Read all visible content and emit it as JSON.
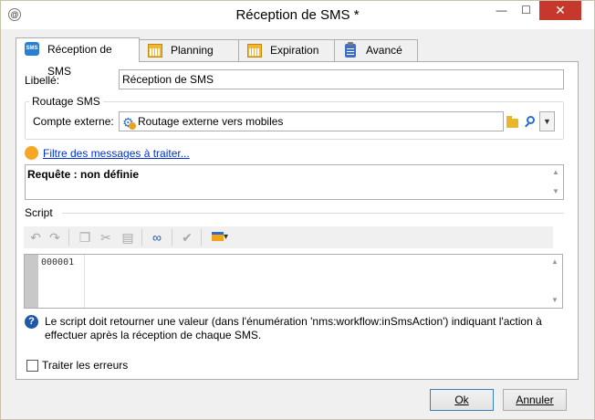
{
  "window": {
    "title": "Réception de SMS *",
    "minimize": "—",
    "maximize": "☐",
    "close": "✕"
  },
  "tabs": [
    {
      "label": "Réception de SMS",
      "icon": "sms-icon",
      "active": true
    },
    {
      "label": "Planning",
      "icon": "calendar-icon",
      "active": false
    },
    {
      "label": "Expiration",
      "icon": "calendar-icon",
      "active": false
    },
    {
      "label": "Avancé",
      "icon": "clipboard-icon",
      "active": false
    }
  ],
  "form": {
    "libelle_label": "Libellé:",
    "libelle_value": "Réception de SMS",
    "routage_group": "Routage SMS",
    "compte_label": "Compte externe:",
    "compte_value": "Routage externe vers mobiles",
    "filter_link": "Filtre des messages à traiter...",
    "query_text": "Requête : non définie",
    "script_group": "Script",
    "script_line": "000001",
    "help_text": "Le script doit retourner une valeur (dans l'énumération 'nms:workflow:inSmsAction') indiquant l'action à effectuer après la réception de chaque SMS.",
    "checkbox_label": "Traiter les erreurs"
  },
  "buttons": {
    "ok": "Ok",
    "cancel": "Annuler"
  },
  "colors": {
    "close_button": "#c7382c",
    "link": "#0033cc",
    "accent_blue": "#1e5aa8",
    "filter_dot": "#f5a623"
  }
}
